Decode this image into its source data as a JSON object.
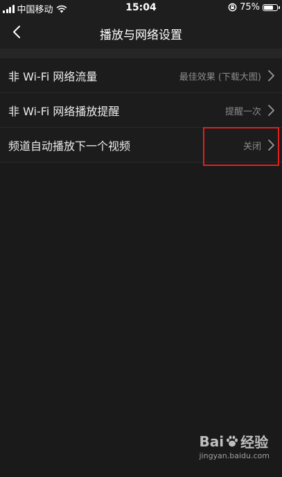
{
  "status_bar": {
    "carrier": "中国移动",
    "time": "15:04",
    "battery_percent": "75%",
    "battery_level": 0.75,
    "icons": [
      "signal-icon",
      "wifi-icon",
      "orientation-lock-icon",
      "battery-icon"
    ]
  },
  "nav": {
    "title": "播放与网络设置",
    "back_icon": "chevron-left-icon"
  },
  "settings": {
    "items": [
      {
        "label": "非 Wi-Fi 网络流量",
        "value": "最佳效果 (下载大图)"
      },
      {
        "label": "非 Wi-Fi 网络播放提醒",
        "value": "提醒一次"
      },
      {
        "label": "频道自动播放下一个视频",
        "value": "关闭"
      }
    ]
  },
  "watermark": {
    "brand_a": "Bai",
    "brand_b": "经验",
    "url": "jingyan.baidu.com"
  },
  "colors": {
    "background": "#1a1a1a",
    "row_background": "#1c1c1c",
    "text_primary": "#ececec",
    "text_secondary": "#8c8c8c",
    "highlight": "#e02020"
  }
}
